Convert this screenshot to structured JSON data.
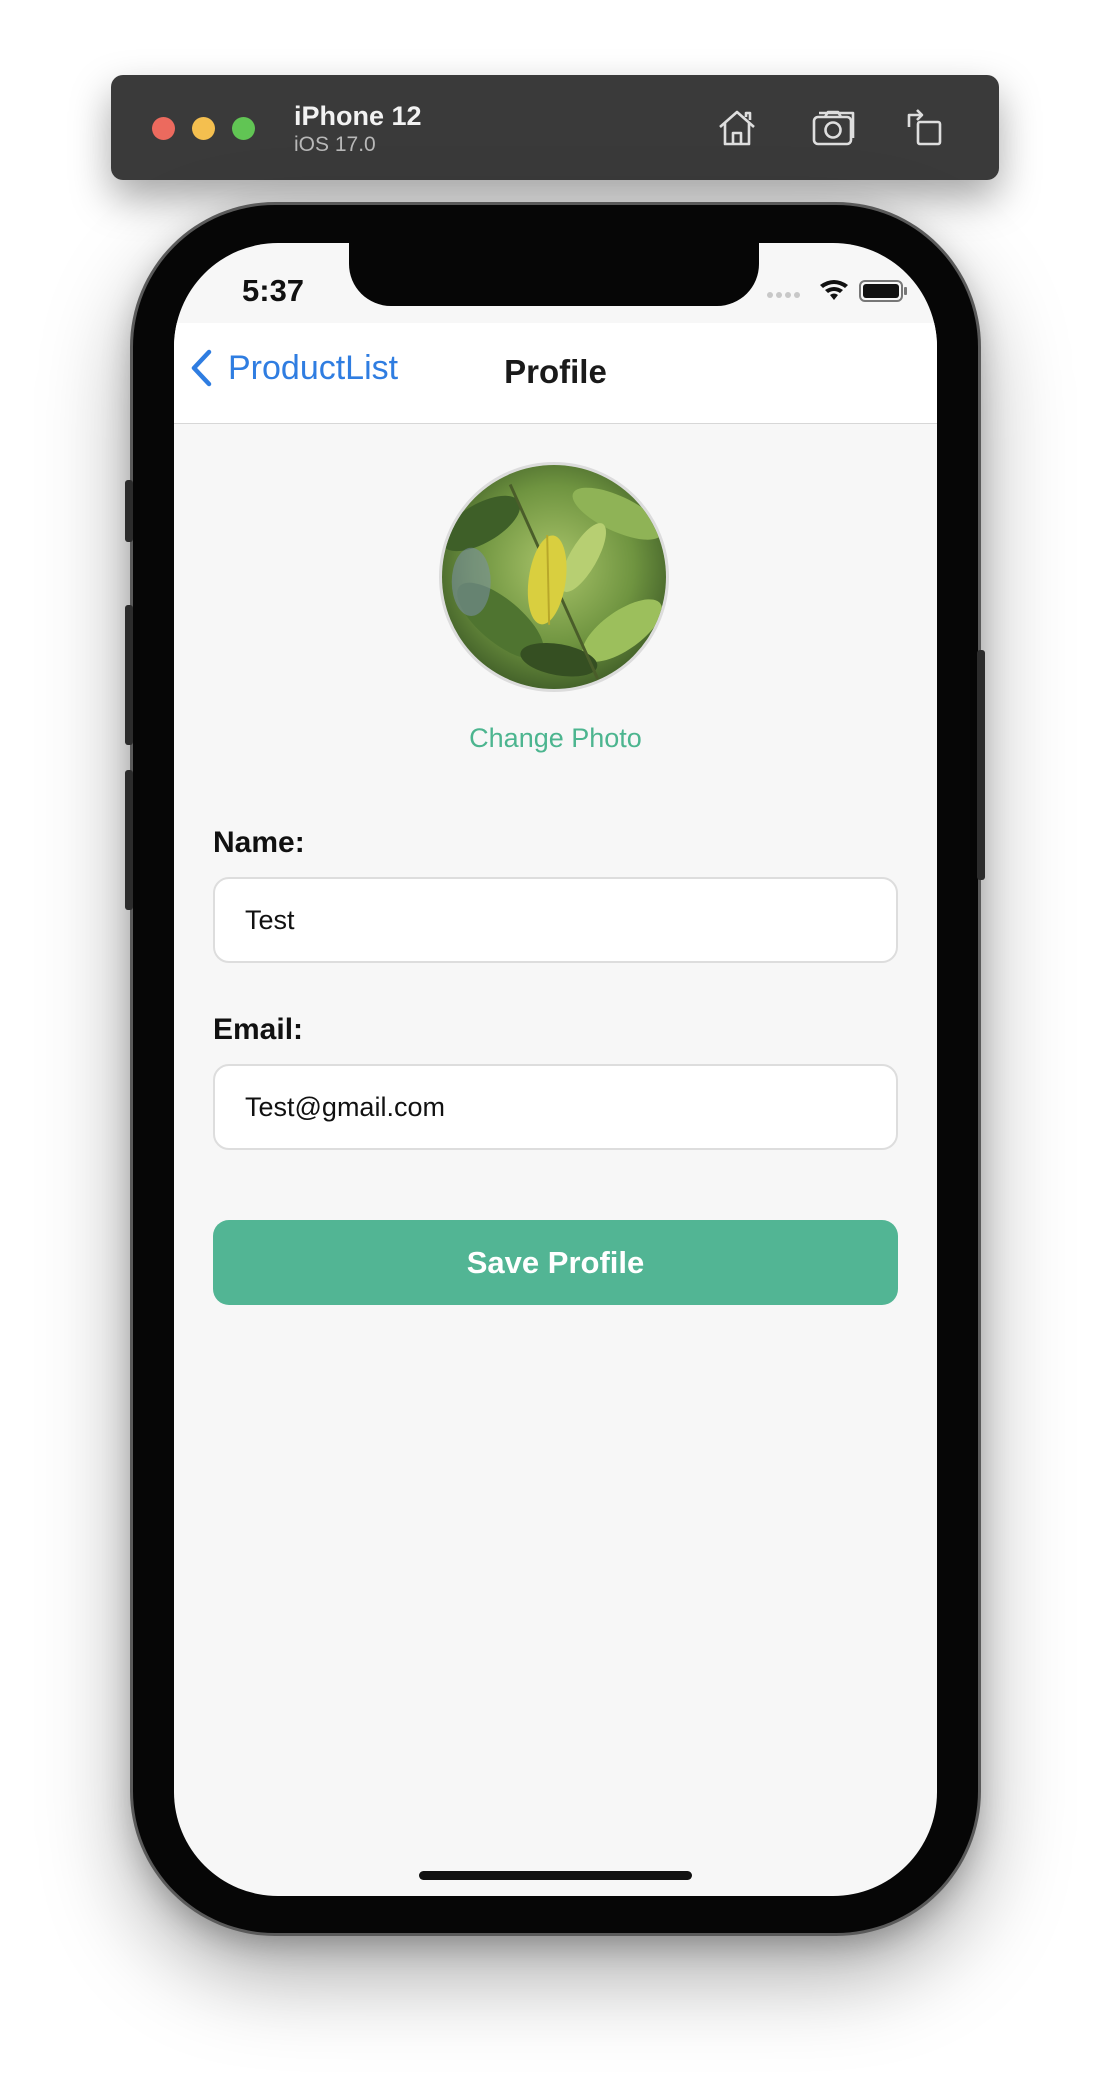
{
  "simulator": {
    "device_name": "iPhone 12",
    "os_version": "iOS 17.0",
    "icons": [
      "home-icon",
      "screenshot-icon",
      "rotate-icon"
    ]
  },
  "status_bar": {
    "time": "5:37",
    "icons": [
      "signal-icon",
      "wifi-icon",
      "battery-icon"
    ]
  },
  "nav": {
    "back_label": "ProductList",
    "title": "Profile"
  },
  "profile": {
    "change_photo_label": "Change Photo",
    "name_label": "Name:",
    "name_value": "Test",
    "email_label": "Email:",
    "email_value": "Test@gmail.com",
    "save_label": "Save Profile"
  },
  "colors": {
    "accent_green": "#52b594",
    "link_blue": "#2f7de1",
    "screen_background": "#f7f7f7"
  }
}
